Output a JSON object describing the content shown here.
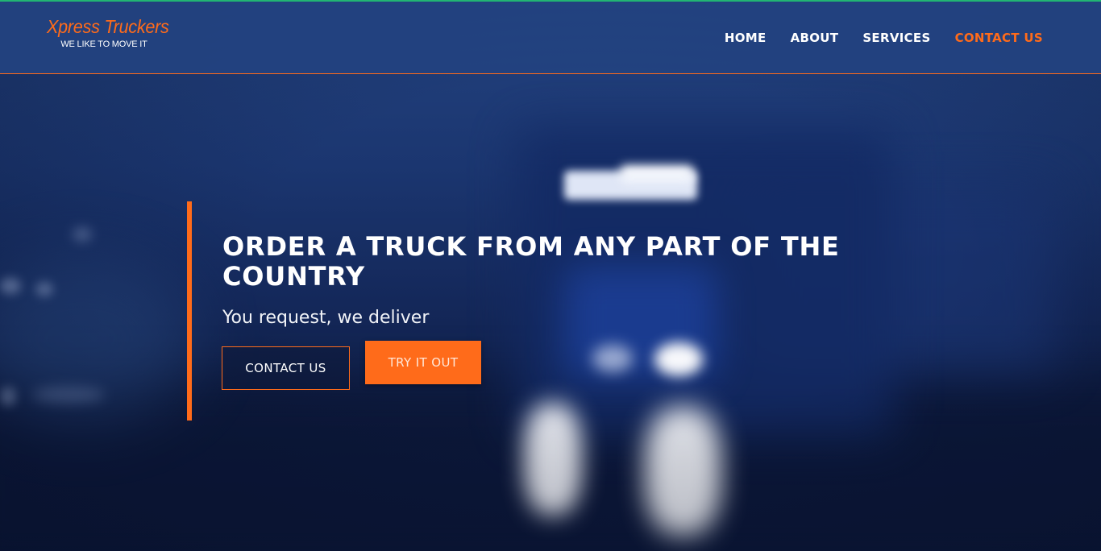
{
  "brand": {
    "name": "Xpress Truckers",
    "tagline": "WE LIKE TO MOVE IT",
    "accent_color": "#ff6b1a",
    "top_line_color": "#22b573"
  },
  "nav": {
    "items": [
      {
        "label": "HOME",
        "active": false
      },
      {
        "label": "ABOUT",
        "active": false
      },
      {
        "label": "SERVICES",
        "active": false
      },
      {
        "label": "CONTACT US",
        "active": true
      }
    ]
  },
  "hero": {
    "title": "ORDER A TRUCK FROM ANY PART OF THE COUNTRY",
    "subtitle": "You request, we deliver",
    "primary_button": "CONTACT US",
    "secondary_button": "TRY IT OUT",
    "background": "blurred-night-truck-photo"
  }
}
